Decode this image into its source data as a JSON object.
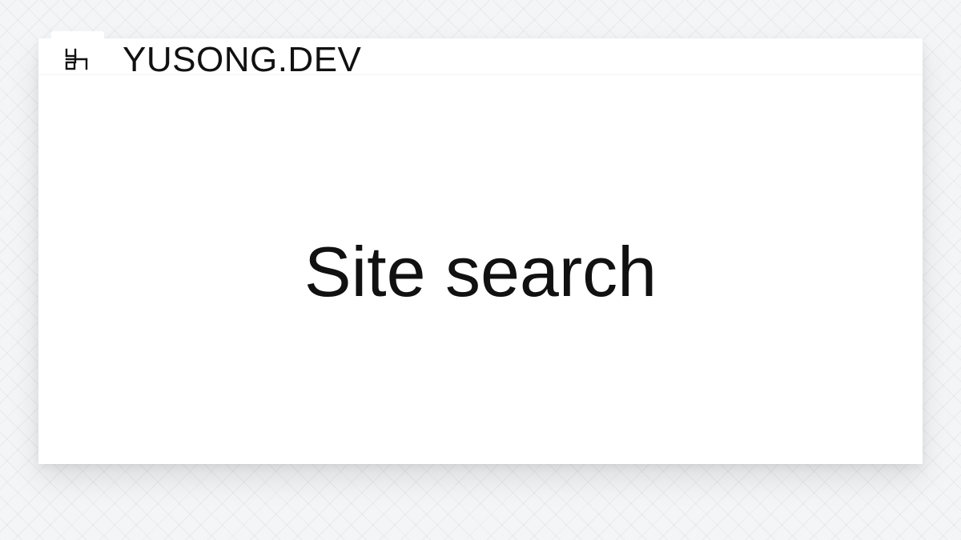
{
  "header": {
    "logo_icon": "yusong-logo-icon",
    "site_name": "YUSONG.DEV"
  },
  "main": {
    "title": "Site search"
  },
  "colors": {
    "background": "#f4f5f7",
    "card": "#ffffff",
    "text": "#111111"
  }
}
